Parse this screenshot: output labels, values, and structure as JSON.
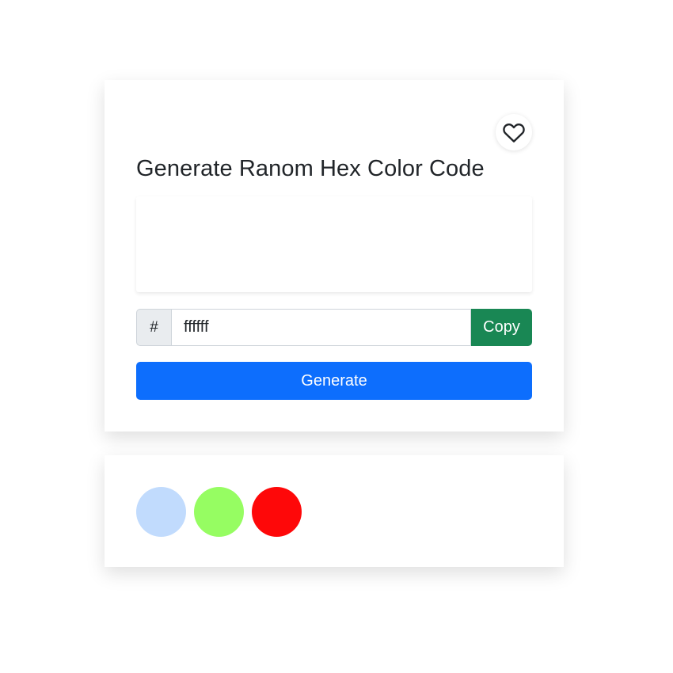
{
  "main": {
    "title": "Generate Ranom Hex Color Code",
    "favorite_icon": "heart-outline-icon",
    "preview_color": "#ffffff",
    "hex_prefix": "#",
    "hex_value": "ffffff",
    "copy_label": "Copy",
    "generate_label": "Generate"
  },
  "colors": {
    "copy_button": "#198754",
    "generate_button": "#0d6efd"
  },
  "history": {
    "swatches": [
      {
        "color": "#c1dbfd"
      },
      {
        "color": "#96fd62"
      },
      {
        "color": "#fe0809"
      }
    ]
  }
}
